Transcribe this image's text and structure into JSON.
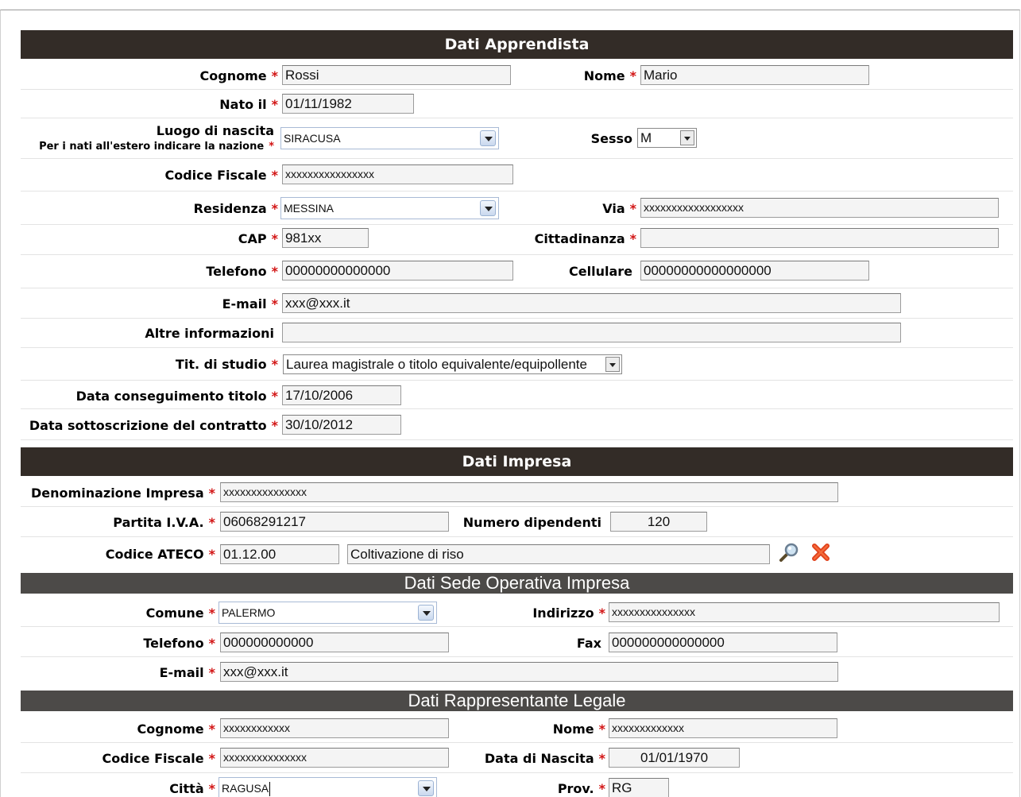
{
  "sections": {
    "apprendista": "Dati Apprendista",
    "impresa": "Dati Impresa",
    "sede": "Dati Sede Operativa Impresa",
    "rappresentante": "Dati Rappresentante Legale"
  },
  "apprendista": {
    "cognome_label": "Cognome",
    "cognome": "Rossi",
    "nome_label": "Nome",
    "nome": "Mario",
    "nato_label": "Nato il",
    "nato": "01/11/1982",
    "luogo_label": "Luogo di nascita",
    "luogo_note": "Per i nati all'estero indicare la nazione",
    "luogo": "SIRACUSA",
    "sesso_label": "Sesso",
    "sesso": "M",
    "cf_label": "Codice Fiscale",
    "cf": "xxxxxxxxxxxxxxxx",
    "residenza_label": "Residenza",
    "residenza": "MESSINA",
    "via_label": "Via",
    "via": "xxxxxxxxxxxxxxxxxx",
    "cap_label": "CAP",
    "cap": "981xx",
    "cittadinanza_label": "Cittadinanza",
    "cittadinanza": "",
    "telefono_label": "Telefono",
    "telefono": "00000000000000",
    "cellulare_label": "Cellulare",
    "cellulare": "00000000000000000",
    "email_label": "E-mail",
    "email": "xxx@xxx.it",
    "altre_label": "Altre informazioni",
    "altre": "",
    "titolo_label": "Tit. di studio",
    "titolo": "Laurea magistrale o titolo equivalente/equipollente",
    "conseguimento_label": "Data conseguimento titolo",
    "conseguimento": "17/10/2006",
    "sottoscrizione_label": "Data sottoscrizione del contratto",
    "sottoscrizione": "30/10/2012"
  },
  "impresa": {
    "denominazione_label": "Denominazione Impresa",
    "denominazione": "xxxxxxxxxxxxxxx",
    "piva_label": "Partita I.V.A.",
    "piva": "06068291217",
    "dipendenti_label": "Numero dipendenti",
    "dipendenti": "120",
    "ateco_label": "Codice ATECO",
    "ateco_code": "01.12.00",
    "ateco_desc": "Coltivazione di riso"
  },
  "sede": {
    "comune_label": "Comune",
    "comune": "PALERMO",
    "indirizzo_label": "Indirizzo",
    "indirizzo": "xxxxxxxxxxxxxxx",
    "telefono_label": "Telefono",
    "telefono": "000000000000",
    "fax_label": "Fax",
    "fax": "000000000000000",
    "email_label": "E-mail",
    "email": "xxx@xxx.it"
  },
  "rappresentante": {
    "cognome_label": "Cognome",
    "cognome": "xxxxxxxxxxxx",
    "nome_label": "Nome",
    "nome": "xxxxxxxxxxxxx",
    "cf_label": "Codice Fiscale",
    "cf": "xxxxxxxxxxxxxxx",
    "nascita_label": "Data di Nascita",
    "nascita": "01/01/1970",
    "citta_label": "Città",
    "citta": "RAGUSA",
    "prov_label": "Prov.",
    "prov": "RG"
  },
  "required_mark": "*",
  "colors": {
    "header_dark": "#332c27",
    "header_gray": "#4c4a48",
    "required": "#d21313"
  },
  "icons": {
    "search": "search-icon",
    "delete": "delete-icon"
  }
}
